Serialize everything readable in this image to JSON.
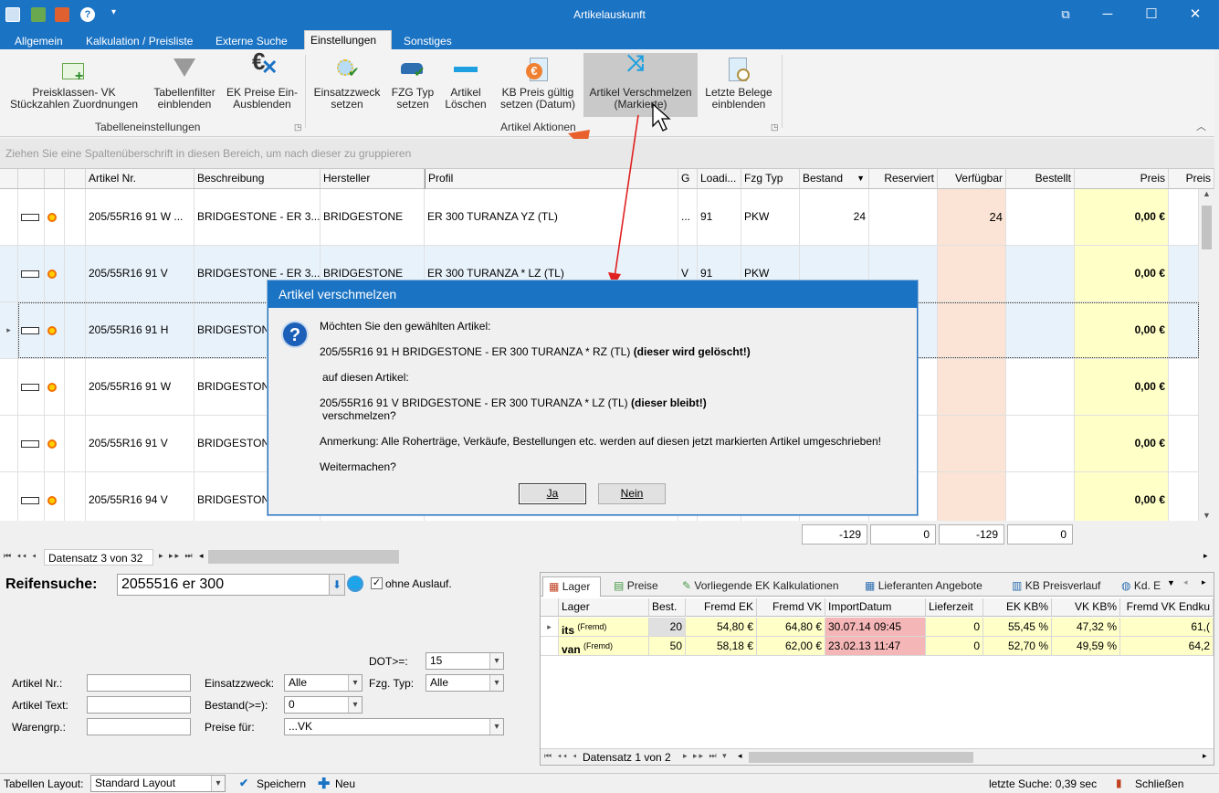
{
  "window": {
    "title": "Artikelauskunft"
  },
  "tabs": [
    "Allgemein",
    "Kalkulation / Preisliste",
    "Externe Suche",
    "Einstellungen",
    "Sonstiges"
  ],
  "ribbon": {
    "buttons": [
      {
        "l1": "Preisklassen- VK",
        "l2": "Stückzahlen Zuordnungen"
      },
      {
        "l1": "Tabellenfilter",
        "l2": "einblenden"
      },
      {
        "l1": "EK Preise Ein-",
        "l2": "Ausblenden"
      },
      {
        "l1": "Einsatzzweck",
        "l2": "setzen"
      },
      {
        "l1": "FZG Typ",
        "l2": "setzen"
      },
      {
        "l1": "Artikel",
        "l2": "Löschen"
      },
      {
        "l1": "KB Preis gültig",
        "l2": "setzen (Datum)"
      },
      {
        "l1": "Artikel Verschmelzen",
        "l2": "(Markierte)"
      },
      {
        "l1": "Letzte Belege",
        "l2": "einblenden"
      }
    ],
    "group1": "Tabelleneinstellungen",
    "group2": "Artikel Aktionen"
  },
  "groupbar": "Ziehen Sie eine Spaltenüberschrift in diesen Bereich, um nach dieser zu gruppieren",
  "grid": {
    "headers": [
      "Artikel Nr.",
      "Beschreibung",
      "Hersteller",
      "Profil",
      "G",
      "Loadi...",
      "Fzg Typ",
      "Bestand",
      "Reserviert",
      "Verfügbar",
      "Bestellt",
      "Preis",
      "Preis"
    ],
    "rows": [
      {
        "artnr": "205/55R16 91 W ...",
        "beschr": "BRIDGESTONE - ER 3...",
        "herst": "BRIDGESTONE",
        "profil": "ER 300 TURANZA YZ (TL)",
        "g": "...",
        "load": "91",
        "fzg": "PKW",
        "bestand": "24",
        "verf": "24",
        "preis": "0,00 €"
      },
      {
        "artnr": "205/55R16 91 V",
        "beschr": "BRIDGESTONE - ER 3...",
        "herst": "BRIDGESTONE",
        "profil": "ER 300 TURANZA * LZ (TL)",
        "g": "V",
        "load": "91",
        "fzg": "PKW",
        "bestand": "",
        "verf": "",
        "preis": "0,00 €"
      },
      {
        "artnr": "205/55R16 91 H",
        "beschr": "BRIDGESTONE",
        "herst": "",
        "profil": "",
        "g": "",
        "load": "",
        "fzg": "",
        "bestand": "",
        "verf": "",
        "preis": "0,00 €"
      },
      {
        "artnr": "205/55R16 91 W",
        "beschr": "BRIDGESTONE",
        "herst": "",
        "profil": "",
        "g": "",
        "load": "",
        "fzg": "",
        "bestand": "",
        "verf": "",
        "preis": "0,00 €"
      },
      {
        "artnr": "205/55R16 91 V",
        "beschr": "BRIDGESTONE",
        "herst": "",
        "profil": "",
        "g": "",
        "load": "",
        "fzg": "",
        "bestand": "",
        "verf": "",
        "preis": "0,00 €"
      },
      {
        "artnr": "205/55R16 94 V",
        "beschr": "BRIDGESTONE",
        "herst": "",
        "profil": "",
        "g": "",
        "load": "",
        "fzg": "",
        "bestand": "",
        "verf": "",
        "preis": "0,00 €"
      }
    ],
    "sums": [
      "-129",
      "0",
      "-129",
      "0"
    ],
    "nav": "Datensatz 3 von 32"
  },
  "search": {
    "label": "Reifensuche:",
    "value": "2055516 er 300",
    "ohne_auslauf": "ohne Auslauf.",
    "dot_label": "DOT>=:",
    "dot_value": "15",
    "artnr_label": "Artikel Nr.:",
    "arttext_label": "Artikel Text:",
    "warengrp_label": "Warengrp.:",
    "einsatz_label": "Einsatzzweck:",
    "einsatz_value": "Alle",
    "fzg_label": "Fzg. Typ:",
    "fzg_value": "Alle",
    "bestand_label": "Bestand(>=):",
    "bestand_value": "0",
    "preise_label": "Preise für:",
    "preise_value": "...VK"
  },
  "lager": {
    "tabs": [
      "Lager",
      "Preise",
      "Vorliegende EK Kalkulationen",
      "Lieferanten Angebote",
      "KB Preisverlauf",
      "Kd. E"
    ],
    "headers": [
      "Lager",
      "Best.",
      "Fremd EK",
      "Fremd VK",
      "ImportDatum",
      "Lieferzeit",
      "EK KB%",
      "VK KB%",
      "Fremd VK Endku"
    ],
    "rows": [
      {
        "lager": "its",
        "tag": "(Fremd)",
        "best": "20",
        "ek": "54,80 €",
        "vk": "64,80 €",
        "datum": "30.07.14 09:45",
        "liefer": "0",
        "ekkb": "55,45 %",
        "vkkb": "47,32 %",
        "endku": "61,("
      },
      {
        "lager": "van",
        "tag": "(Fremd)",
        "best": "50",
        "ek": "58,18 €",
        "vk": "62,00 €",
        "datum": "23.02.13 11:47",
        "liefer": "0",
        "ekkb": "52,70 %",
        "vkkb": "49,59 %",
        "endku": "64,2"
      }
    ],
    "nav": "Datensatz 1 von 2"
  },
  "status": {
    "layout_label": "Tabellen Layout:",
    "layout_value": "Standard Layout",
    "save": "Speichern",
    "new": "Neu",
    "last_search": "letzte Suche: 0,39 sec",
    "close": "Schließen"
  },
  "dialog": {
    "title": "Artikel verschmelzen",
    "q": "Möchten Sie den gewählten Artikel:",
    "a1": "205/55R16 91 H BRIDGESTONE - ER 300 TURANZA * RZ (TL)",
    "a1b": "(dieser wird gelöscht!)",
    "onto": "auf diesen Artikel:",
    "a2": "205/55R16 91 V BRIDGESTONE - ER 300 TURANZA * LZ (TL)",
    "a2b": "(dieser bleibt!)",
    "merge": "verschmelzen?",
    "note": "Anmerkung: Alle Roherträge, Verkäufe, Bestellungen etc. werden auf diesen jetzt markierten Artikel umgeschrieben!",
    "cont": "Weitermachen?",
    "yes": "Ja",
    "no": "Nein"
  },
  "colors": {
    "accent": "#1b73c4",
    "yellow": "#ffffc8",
    "peach": "#fbe4d5",
    "pinkdate": "#f4b6b6",
    "orange": "#e8602c",
    "red": "#e02020"
  }
}
